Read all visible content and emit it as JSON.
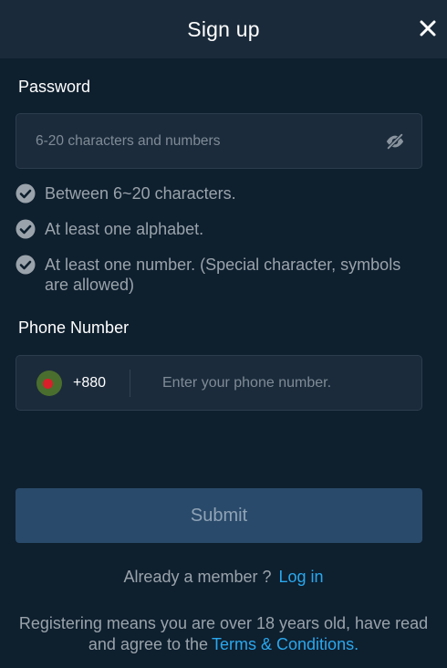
{
  "header": {
    "title": "Sign up",
    "close_icon": "close-icon"
  },
  "password": {
    "label": "Password",
    "placeholder": "6-20 characters and numbers",
    "value": "",
    "toggle_icon": "eye-off-icon",
    "rules": [
      {
        "text": "Between 6~20 characters.",
        "icon": "check-circle-icon"
      },
      {
        "text": "At least one alphabet.",
        "icon": "check-circle-icon"
      },
      {
        "text": "At least one number. (Special character, symbols are allowed)",
        "icon": "check-circle-icon"
      }
    ]
  },
  "phone": {
    "label": "Phone Number",
    "country_flag": "bangladesh-flag-icon",
    "country_code": "+880",
    "placeholder": "Enter your phone number.",
    "value": ""
  },
  "submit": {
    "label": "Submit"
  },
  "login_prompt": {
    "text": "Already a member ?",
    "link": "Log in"
  },
  "terms": {
    "text": "Registering means you are over 18 years old, have read and agree to the",
    "link": "Terms & Conditions."
  },
  "colors": {
    "background": "#0e1f2e",
    "header": "#1a2a3a",
    "field": "#1b2b3b",
    "submit": "#2a4a6b",
    "link": "#2aa8ee",
    "muted_text": "#9aa3ab"
  }
}
